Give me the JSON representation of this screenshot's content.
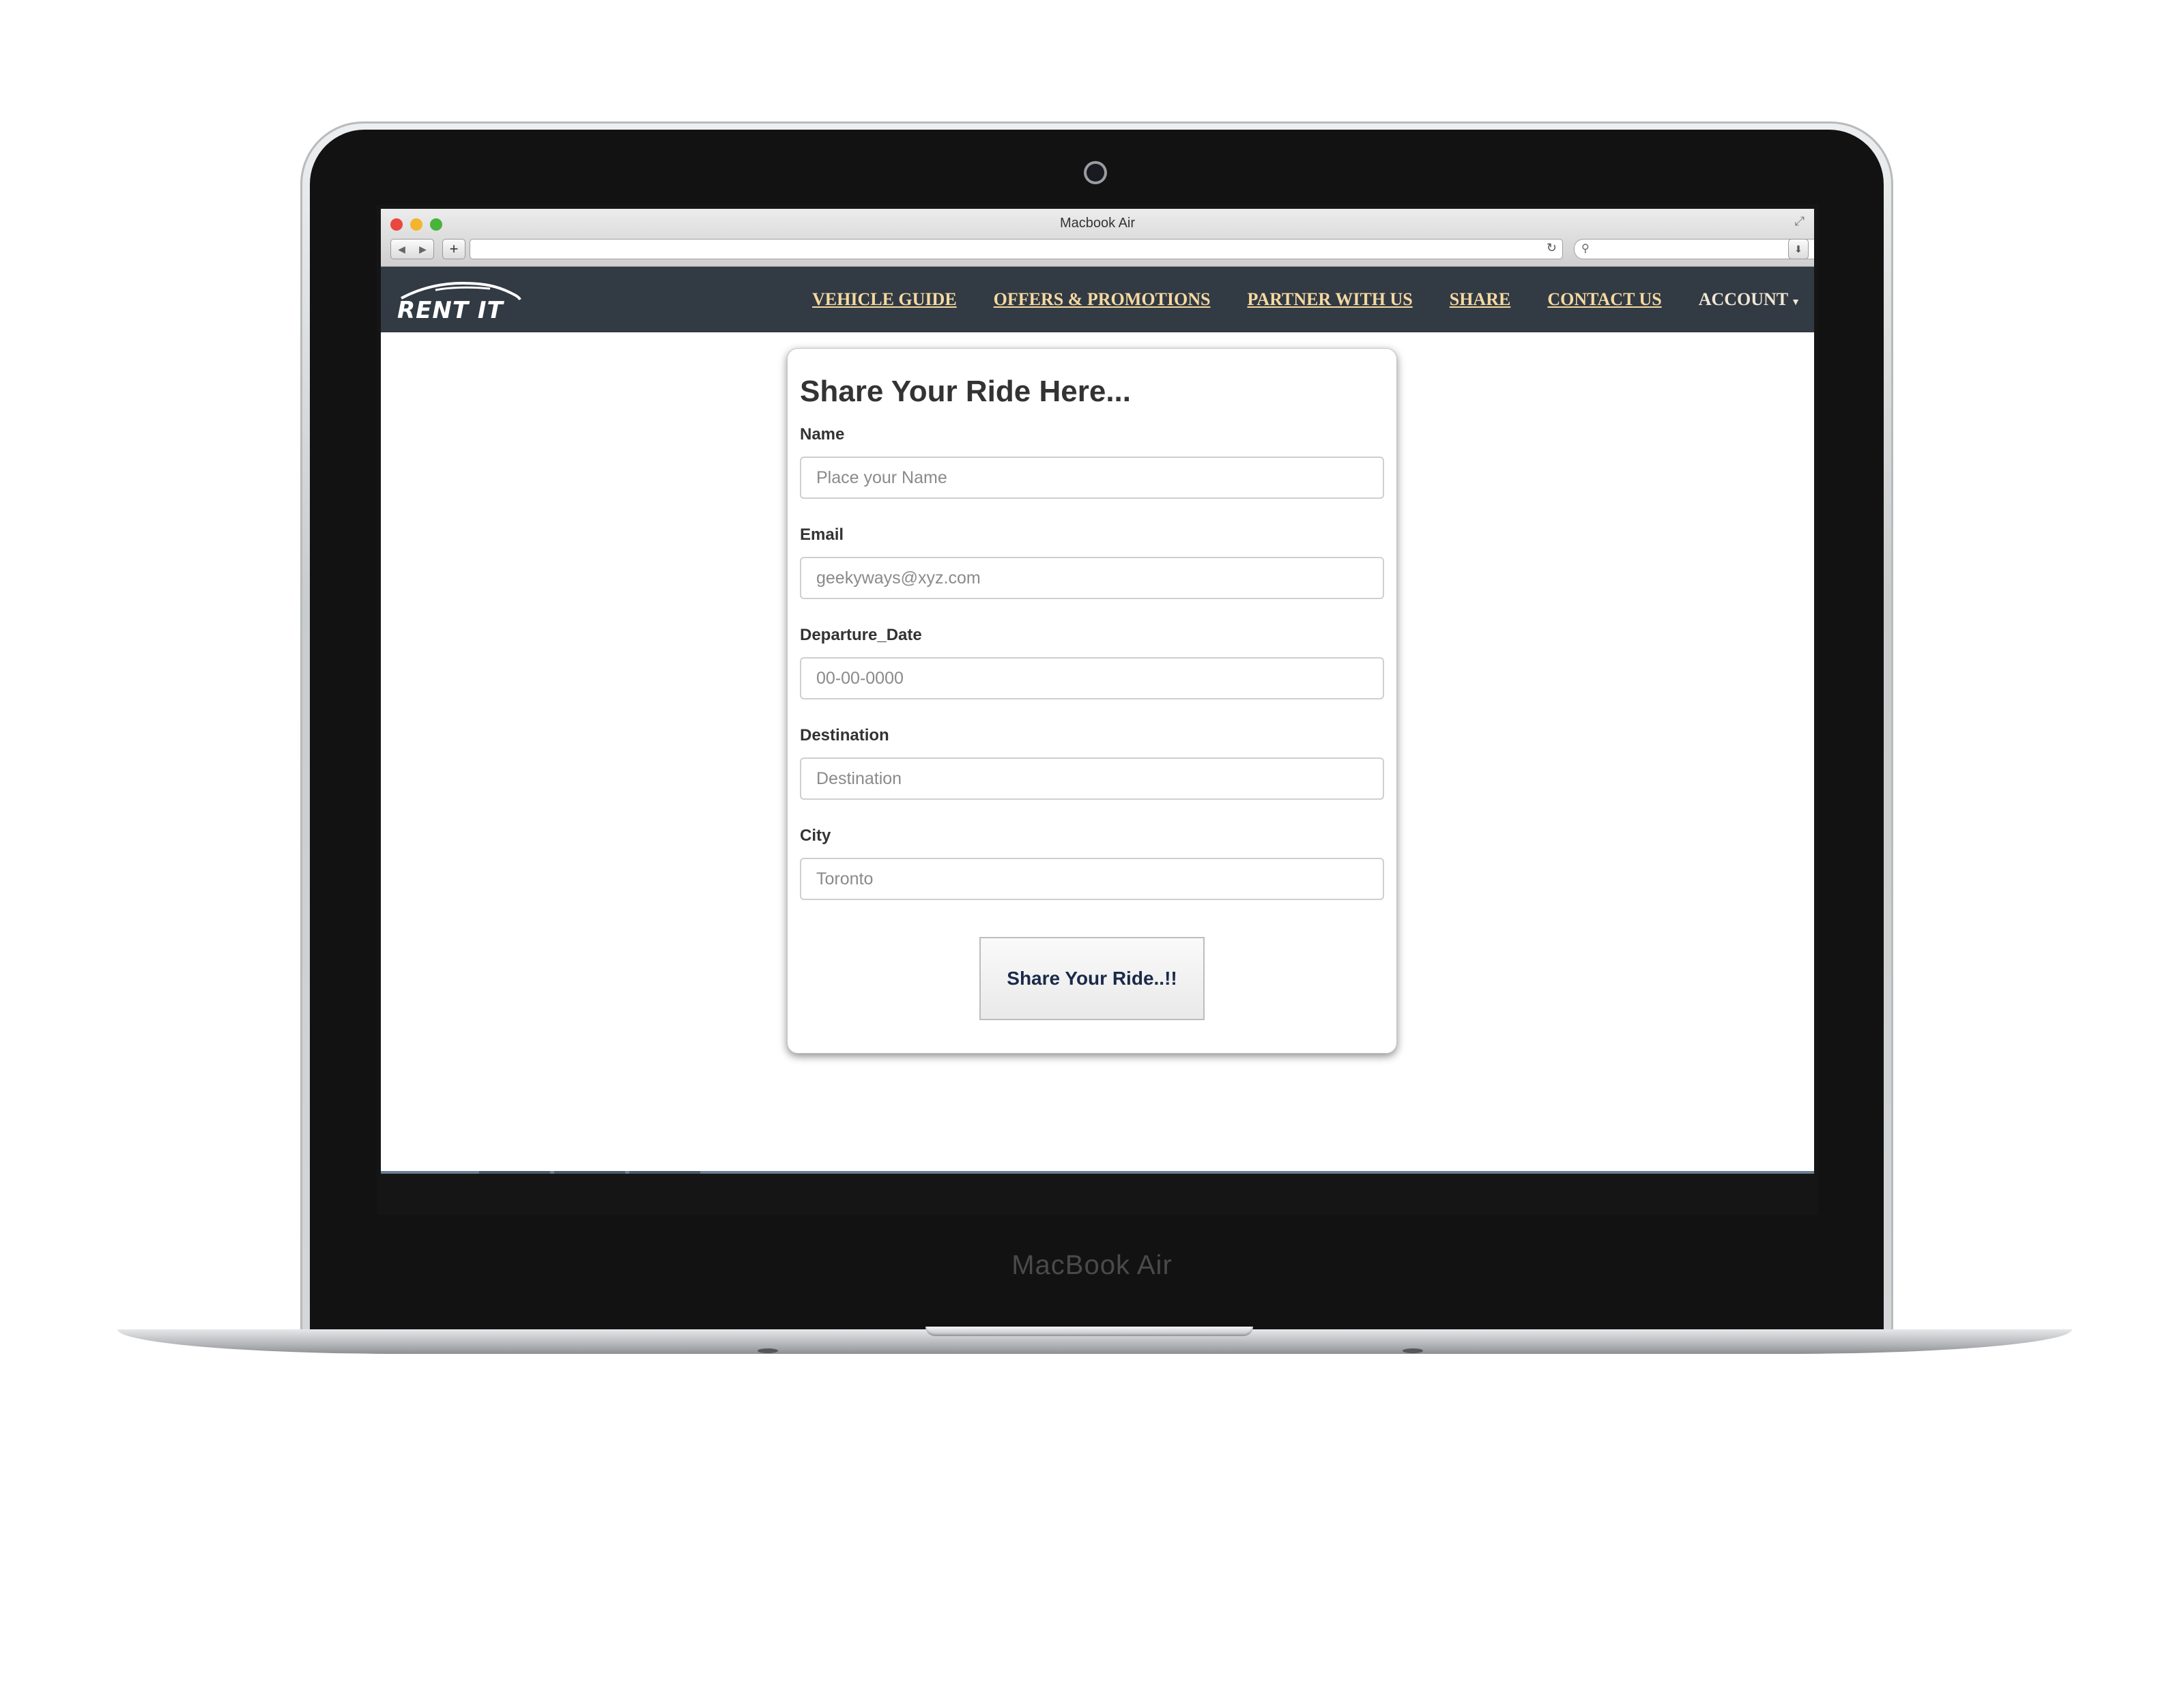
{
  "device": {
    "brand_text": "MacBook Air"
  },
  "browser": {
    "window_title": "Macbook Air",
    "address_value": "",
    "search_value": ""
  },
  "site": {
    "logo_text": "RENT IT",
    "nav": [
      {
        "label": "VEHICLE GUIDE"
      },
      {
        "label": "OFFERS & PROMOTIONS"
      },
      {
        "label": "PARTNER WITH US"
      },
      {
        "label": "SHARE"
      },
      {
        "label": "CONTACT US"
      }
    ],
    "account_label": "ACCOUNT"
  },
  "form": {
    "title": "Share Your Ride Here...",
    "fields": [
      {
        "label": "Name",
        "placeholder": "Place your Name",
        "value": ""
      },
      {
        "label": "Email",
        "placeholder": "geekyways@xyz.com",
        "value": ""
      },
      {
        "label": "Departure_Date",
        "placeholder": "00-00-0000",
        "value": ""
      },
      {
        "label": "Destination",
        "placeholder": "Destination",
        "value": ""
      },
      {
        "label": "City",
        "placeholder": "Toronto",
        "value": ""
      }
    ],
    "submit_label": "Share Your Ride..!!"
  },
  "colors": {
    "nav_background": "#323a44",
    "nav_link": "#f5d9a0",
    "button_text": "#1a2a4a"
  }
}
